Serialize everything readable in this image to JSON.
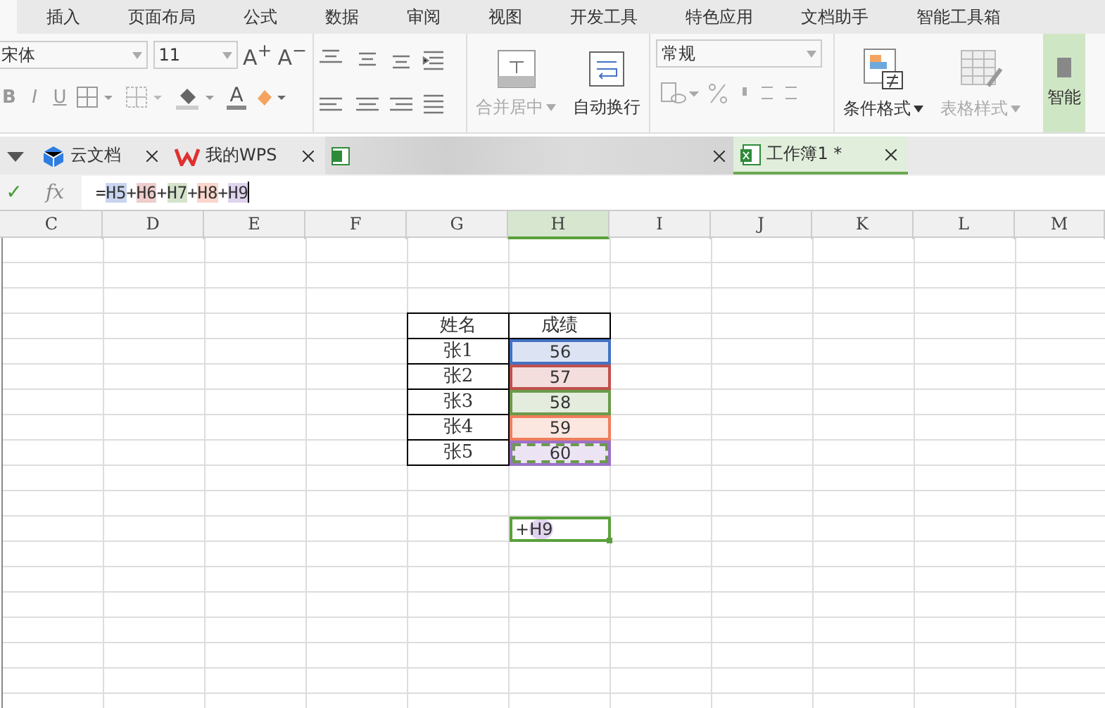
{
  "menu_tabs": [
    {
      "selected": true
    },
    {
      "label": "插入",
      "selected": false
    },
    {
      "label": "页面布局",
      "selected": false
    },
    {
      "label": "公式",
      "selected": false
    },
    {
      "label": "数据",
      "selected": false
    },
    {
      "label": "审阅",
      "selected": false
    },
    {
      "label": "视图",
      "selected": false
    },
    {
      "label": "开发工具",
      "selected": false
    },
    {
      "label": "特色应用",
      "selected": false
    },
    {
      "label": "文档助手",
      "selected": false
    },
    {
      "label": "智能工具箱",
      "selected": false
    }
  ],
  "toolbar": {
    "font_name": "宋体",
    "font_size": "11",
    "grow_font": "A$^{+}$",
    "shrink_font": "A$^{−}$",
    "style_buttons": [
      "B",
      "I",
      "U"
    ],
    "font_color": "A",
    "merge": {
      "label": "合并居中",
      "disabled": true
    },
    "wrap": {
      "label": "自动换行",
      "disabled": false
    },
    "number_format": "常规",
    "conditional": {
      "label": "条件格式",
      "disabled": false
    },
    "table_style": {
      "label": "表格样式",
      "disabled": true
    },
    "smart": "智能"
  },
  "doc_tabs": [
    {
      "kind": "cloud",
      "label": "云文档",
      "selected": false
    },
    {
      "kind": "wps",
      "label": "我的WPS",
      "selected": false
    },
    {
      "kind": "blurred",
      "selected": false
    },
    {
      "kind": "sheet",
      "label": "工作簿1 *",
      "selected": true
    }
  ],
  "formula_bar": {
    "confirm": "✓",
    "fx": "fx",
    "parts": [
      {
        "text": "="
      },
      {
        "text": "H5",
        "color": "#c9d5ef"
      },
      {
        "text": "+"
      },
      {
        "text": "H6",
        "color": "#eecdcc"
      },
      {
        "text": "+"
      },
      {
        "text": "H7",
        "color": "#d5e3cc"
      },
      {
        "text": "+"
      },
      {
        "text": "H8",
        "color": "#fad6cc"
      },
      {
        "text": "+"
      },
      {
        "text": "H9",
        "color": "#e0d3ef"
      }
    ]
  },
  "columns": [
    {
      "label": "C",
      "selected": false
    },
    {
      "label": "D",
      "selected": false
    },
    {
      "label": "E",
      "selected": false
    },
    {
      "label": "F",
      "selected": false
    },
    {
      "label": "G",
      "selected": false
    },
    {
      "label": "H",
      "selected": true
    },
    {
      "label": "I",
      "selected": false
    },
    {
      "label": "J",
      "selected": false
    },
    {
      "label": "K",
      "selected": false
    },
    {
      "label": "L",
      "selected": false
    },
    {
      "label": "M",
      "selected": false
    }
  ],
  "table": {
    "header": [
      "姓名",
      "成绩"
    ],
    "rows": [
      {
        "name": "张1",
        "score": "56",
        "color": "#4472c4",
        "marquee": false
      },
      {
        "name": "张2",
        "score": "57",
        "color": "#c0504d",
        "marquee": false
      },
      {
        "name": "张3",
        "score": "58",
        "color": "#6b9a4a",
        "marquee": false
      },
      {
        "name": "张4",
        "score": "59",
        "color": "#f07d5c",
        "marquee": false
      },
      {
        "name": "张5",
        "score": "60",
        "color": "#9b72c8",
        "marquee": true
      }
    ]
  },
  "active_cell": {
    "parts": [
      {
        "text": "+"
      },
      {
        "text": "H9",
        "color": "#e0d3ef"
      }
    ]
  }
}
